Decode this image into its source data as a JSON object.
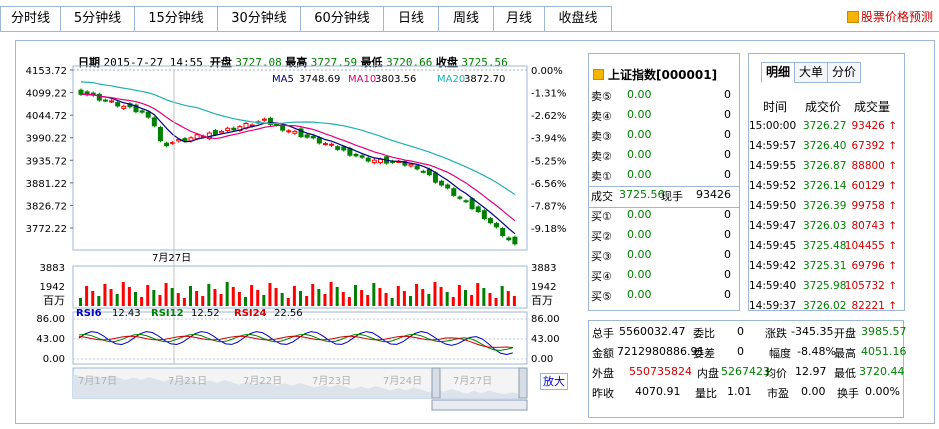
{
  "tabs": [
    "分时线",
    "5分钟线",
    "15分钟线",
    "30分钟线",
    "60分钟线",
    "日线",
    "周线",
    "月线",
    "收盘线"
  ],
  "active_tab": 1,
  "predict_label": "股票价格预测",
  "info": {
    "date_label": "日期",
    "date": "2015-7-27 14:55",
    "open_label": "开盘",
    "open": "3727.08",
    "high_label": "最高",
    "high": "3727.59",
    "low_label": "最低",
    "low": "3720.66",
    "close_label": "收盘",
    "close": "3725.56"
  },
  "ma": {
    "ma5_label": "MA5",
    "ma5": "3748.69",
    "ma10_label": "MA10",
    "ma10": "3803.56",
    "ma20_label": "MA20",
    "ma20": "3872.70"
  },
  "price_axis": [
    "4153.72",
    "4099.22",
    "4044.72",
    "3990.22",
    "3935.72",
    "3881.22",
    "3826.72",
    "3772.22"
  ],
  "pct_axis": [
    "0.00%",
    "-1.31%",
    "-2.62%",
    "-3.94%",
    "-5.25%",
    "-6.56%",
    "-7.87%",
    "-9.18%"
  ],
  "date_marker": "7月27日",
  "vol_axis": {
    "top": "3883",
    "mid": "1942",
    "unit": "百万"
  },
  "rsi": {
    "rsi6_label": "RSI6",
    "rsi6": "12.43",
    "rsi12_label": "RSI12",
    "rsi12": "12.52",
    "rsi24_label": "RSI24",
    "rsi24": "22.56",
    "axis": [
      "86.00",
      "43.00",
      "0.00"
    ]
  },
  "overview_dates": [
    "7月17日",
    "7月21日",
    "7月22日",
    "7月23日",
    "7月24日",
    "7月27日"
  ],
  "zoom_label": "放大",
  "orderbook": {
    "title": "上证指数[000001]",
    "sell": [
      {
        "label": "卖⑤",
        "price": "0.00",
        "vol": "0"
      },
      {
        "label": "卖④",
        "price": "0.00",
        "vol": "0"
      },
      {
        "label": "卖③",
        "price": "0.00",
        "vol": "0"
      },
      {
        "label": "卖②",
        "price": "0.00",
        "vol": "0"
      },
      {
        "label": "卖①",
        "price": "0.00",
        "vol": "0"
      }
    ],
    "trade": {
      "label": "成交",
      "price": "3725.56",
      "hand_label": "现手",
      "hand": "93426"
    },
    "buy": [
      {
        "label": "买①",
        "price": "0.00",
        "vol": "0"
      },
      {
        "label": "买②",
        "price": "0.00",
        "vol": "0"
      },
      {
        "label": "买③",
        "price": "0.00",
        "vol": "0"
      },
      {
        "label": "买④",
        "price": "0.00",
        "vol": "0"
      },
      {
        "label": "买⑤",
        "price": "0.00",
        "vol": "0"
      }
    ]
  },
  "detail": {
    "tabs": [
      "明细",
      "大单",
      "分价"
    ],
    "headers": [
      "时间",
      "成交价",
      "成交量"
    ],
    "rows": [
      {
        "time": "15:00:00",
        "price": "3726.27",
        "vol": "93426"
      },
      {
        "time": "14:59:57",
        "price": "3726.40",
        "vol": "67392"
      },
      {
        "time": "14:59:55",
        "price": "3726.87",
        "vol": "88800"
      },
      {
        "time": "14:59:52",
        "price": "3726.14",
        "vol": "60129"
      },
      {
        "time": "14:59:50",
        "price": "3726.39",
        "vol": "99758"
      },
      {
        "time": "14:59:47",
        "price": "3726.03",
        "vol": "80743"
      },
      {
        "time": "14:59:45",
        "price": "3725.48",
        "vol": "104455"
      },
      {
        "time": "14:59:42",
        "price": "3725.31",
        "vol": "69796"
      },
      {
        "time": "14:59:40",
        "price": "3725.98",
        "vol": "105732"
      },
      {
        "time": "14:59:37",
        "price": "3726.02",
        "vol": "82221"
      }
    ]
  },
  "stats": {
    "total_hand_label": "总手",
    "total_hand": "5560032.47",
    "weibi_label": "委比",
    "weibi": "0",
    "change_label": "涨跌",
    "change": "-345.35",
    "open_label": "开盘",
    "open": "3985.57",
    "amount_label": "金额",
    "amount": "7212980886.91",
    "weicha_label": "委差",
    "weicha": "0",
    "amp_label": "幅度",
    "amp": "-8.48%",
    "high_label": "最高",
    "high": "4051.16",
    "outer_label": "外盘",
    "outer": "550735824",
    "inner_label": "内盘",
    "inner": "5267423",
    "avg_label": "均价",
    "avg": "12.97",
    "low_label": "最低",
    "low": "3720.44",
    "prev_label": "昨收",
    "prev": "4070.91",
    "volratio_label": "量比",
    "volratio": "1.01",
    "pe_label": "市盈",
    "pe": "0.00",
    "turnover_label": "换手",
    "turnover": "0.00%"
  },
  "colors": {
    "up": "#ff0000",
    "down": "#008000",
    "ma5": "#000080",
    "ma10": "#e0007a",
    "ma20": "#20b0b0",
    "border": "#9db7d8"
  }
}
